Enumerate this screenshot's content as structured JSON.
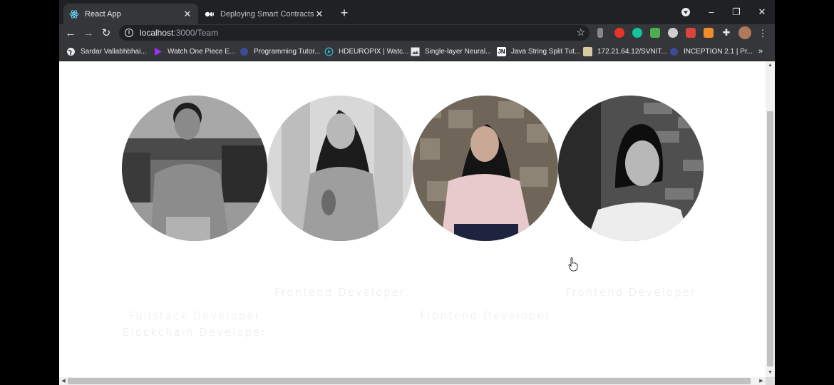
{
  "tabs": [
    {
      "title": "React App",
      "icon": "react-icon",
      "active": true
    },
    {
      "title": "Deploying Smart Contracts with",
      "icon": "medium-icon",
      "active": false
    }
  ],
  "address": {
    "host": "localhost",
    "path": ":3000/Team"
  },
  "bookmarks": [
    {
      "label": "Sardar Vallabhbhai...",
      "icon": "globe-icon",
      "color": "#e8eaed"
    },
    {
      "label": "Watch One Piece E...",
      "icon": "play-icon",
      "color": "#9b30ff"
    },
    {
      "label": "Programming Tutor...",
      "icon": "globe-icon",
      "color": "#3c4a9a"
    },
    {
      "label": "HDEUROPIX | Watc...",
      "icon": "play-circle-icon",
      "color": "#2fb6c9"
    },
    {
      "label": "Single-layer Neural...",
      "icon": "image-icon",
      "color": "#e8eaed"
    },
    {
      "label": "Java String Split Tut...",
      "icon": "jn-icon",
      "color": "#ffffff"
    },
    {
      "label": "172.21.64.12/SVNIT...",
      "icon": "page-icon",
      "color": "#d8c9a0"
    },
    {
      "label": "INCEPTION 2.1 | Pr...",
      "icon": "globe-icon",
      "color": "#3c4a9a"
    }
  ],
  "team": [
    {
      "roles": [
        "Fullstack Developer",
        "Blockchain Developer"
      ]
    },
    {
      "roles": [
        "Frontend Developer"
      ]
    },
    {
      "roles": [
        "Frontend Developer"
      ]
    },
    {
      "roles": [
        "Frontend Developer"
      ]
    }
  ],
  "colors": {
    "chrome_dark": "#202124",
    "chrome_mid": "#35363a",
    "role_text": "#e6e6e6"
  }
}
